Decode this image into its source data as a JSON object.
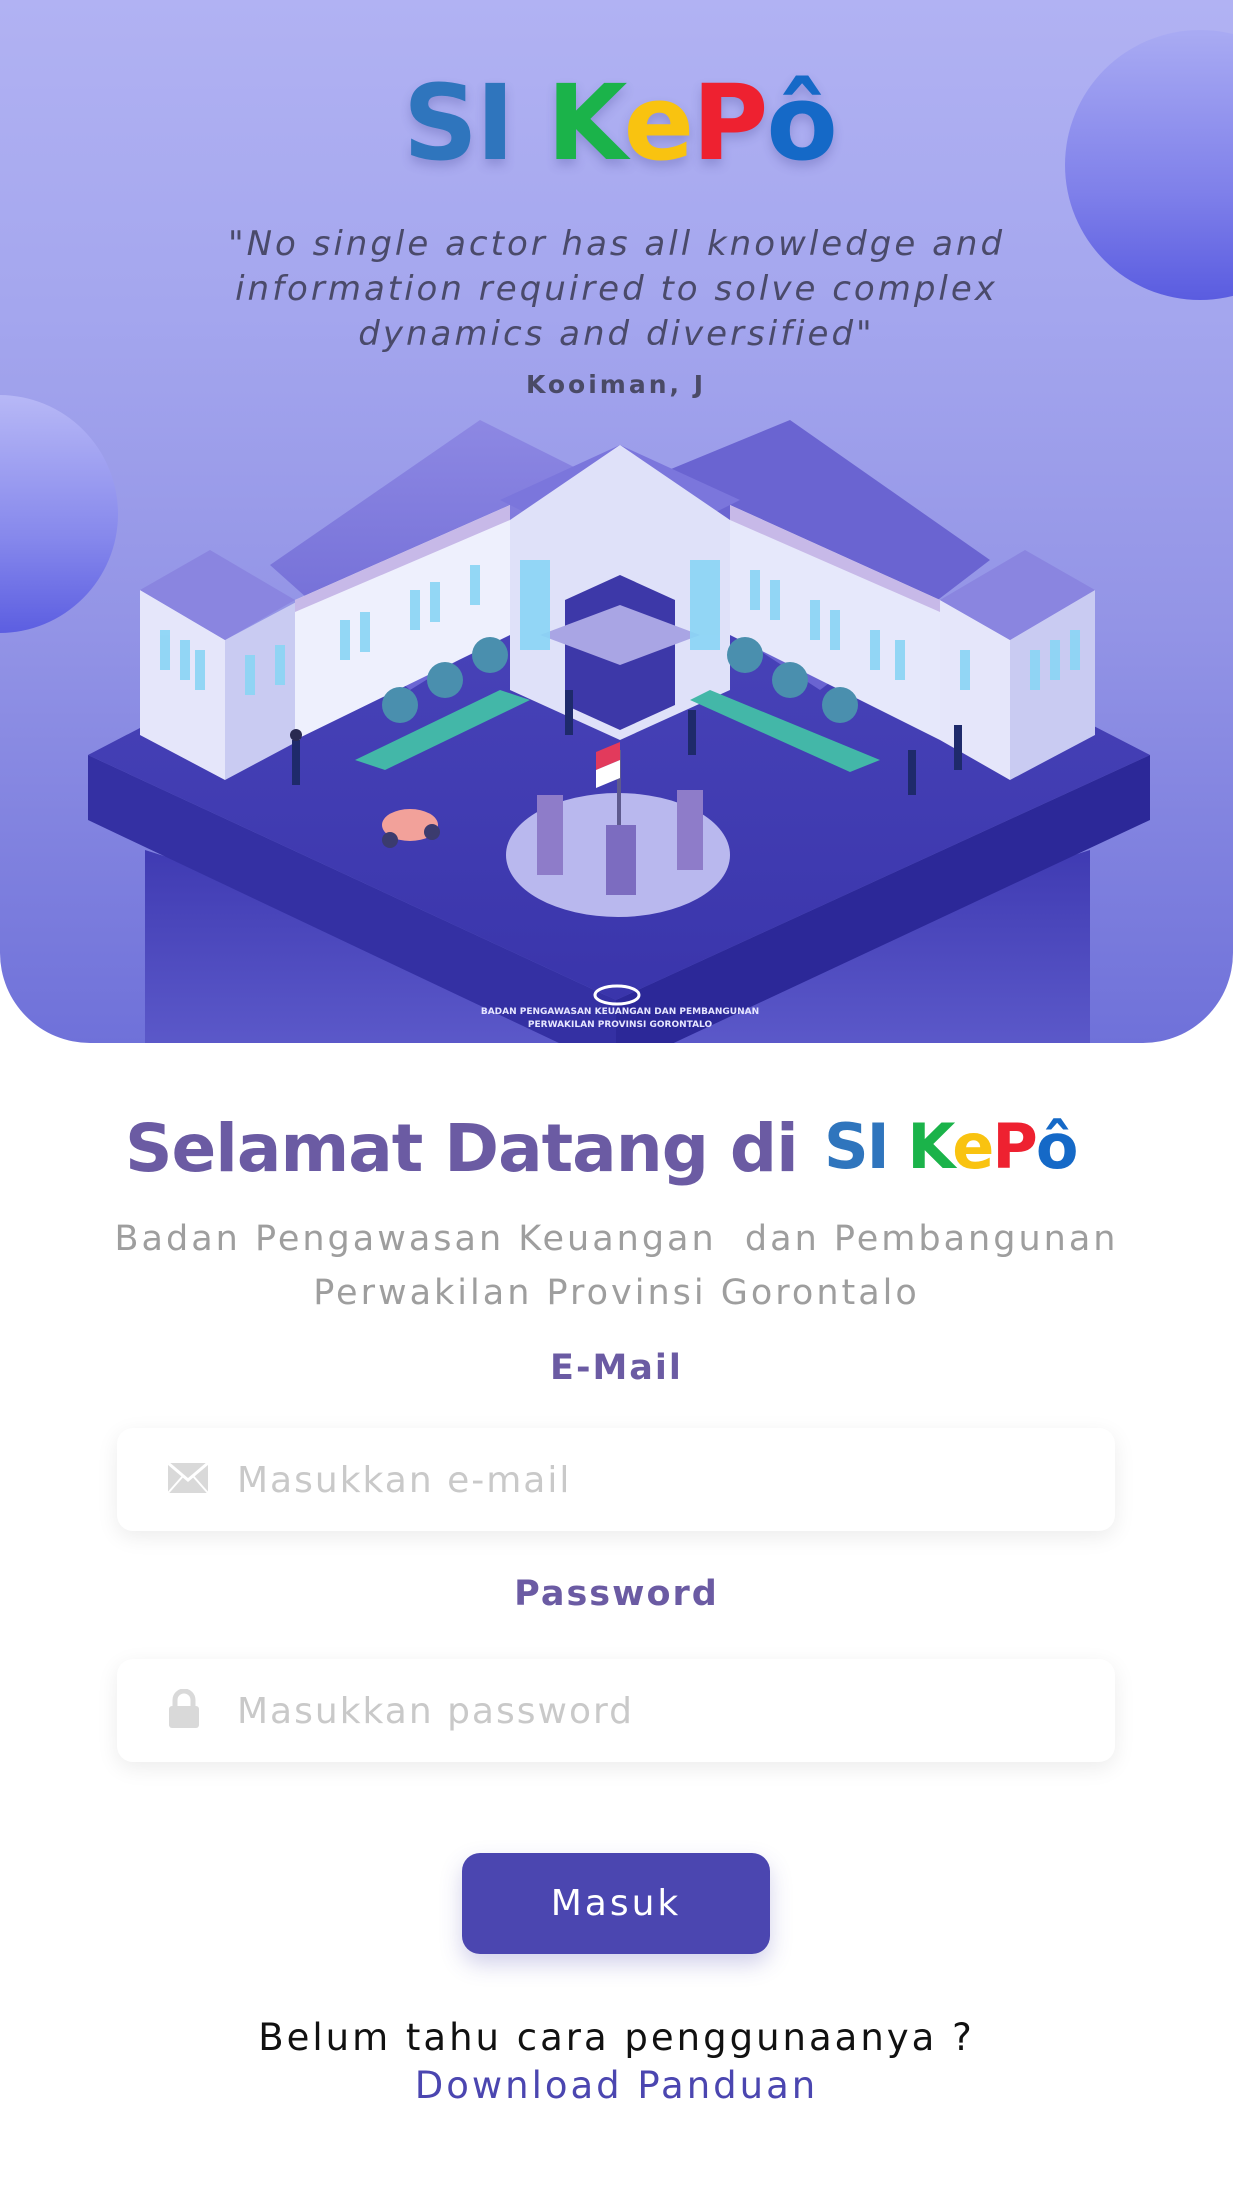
{
  "brand": {
    "s": "S",
    "i": "I",
    "k": "K",
    "e": "e",
    "p": "P",
    "o": "ô"
  },
  "hero": {
    "quote": "\"No single actor has all knowledge and information required to solve complex dynamics and diversified\"",
    "author": "Kooiman, J",
    "org_caption_line1": "BADAN PENGAWASAN KEUANGAN DAN PEMBANGUNAN",
    "org_caption_line2": "PERWAKILAN PROVINSI GORONTALO",
    "org_logo_text": "bpkp"
  },
  "welcome": {
    "title": "Selamat Datang di",
    "subtitle_line1": "Badan Pengawasan Keuangan  dan Pembangunan",
    "subtitle_line2": "Perwakilan Provinsi Gorontalo"
  },
  "form": {
    "email_label": "E-Mail",
    "email_placeholder": "Masukkan e-mail",
    "email_value": "",
    "password_label": "Password",
    "password_placeholder": "Masukkan password",
    "password_value": "",
    "submit_label": "Masuk"
  },
  "footer": {
    "help_text": "Belum tahu cara penggunaanya ?",
    "download_link": "Download Panduan"
  },
  "colors": {
    "accent": "#4b46b0",
    "heading": "#6b5ba3",
    "hero_top": "#b1b2f3",
    "hero_bottom": "#6f71d9"
  },
  "icons": {
    "email": "envelope-icon",
    "password": "lock-icon"
  }
}
